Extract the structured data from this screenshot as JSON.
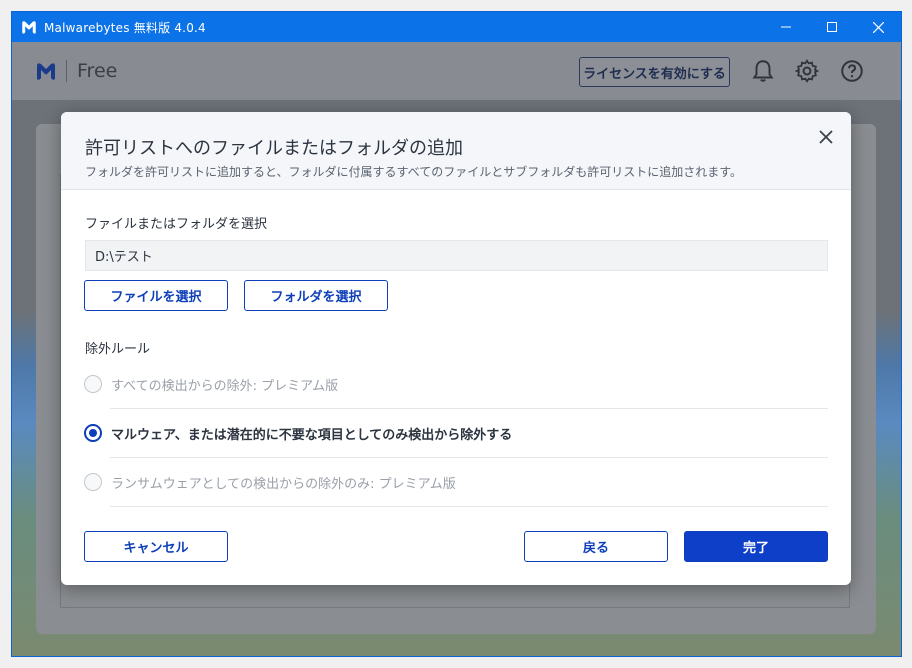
{
  "window": {
    "title": "Malwarebytes 無料版  4.0.4"
  },
  "header": {
    "edition": "Free",
    "license_button": "ライセンスを有効にする"
  },
  "dialog": {
    "title": "許可リストへのファイルまたはフォルダの追加",
    "subtitle": "フォルダを許可リストに追加すると、フォルダに付属するすべてのファイルとサブフォルダも許可リストに追加されます。",
    "select_label": "ファイルまたはフォルダを選択",
    "path_value": "D:\\テスト",
    "select_file_button": "ファイルを選択",
    "select_folder_button": "フォルダを選択",
    "rules_label": "除外ルール",
    "rules": [
      {
        "label": "すべての検出からの除外: プレミアム版",
        "selected": false,
        "disabled": true
      },
      {
        "label": "マルウェア、または潜在的に不要な項目としてのみ検出から除外する",
        "selected": true,
        "disabled": false
      },
      {
        "label": "ランサムウェアとしての検出からの除外のみ: プレミアム版",
        "selected": false,
        "disabled": true
      }
    ],
    "cancel_button": "キャンセル",
    "back_button": "戻る",
    "done_button": "完了"
  },
  "colors": {
    "titlebar": "#0b72e7",
    "accent": "#0d3fb8",
    "primary_button": "#0d3fc8"
  }
}
